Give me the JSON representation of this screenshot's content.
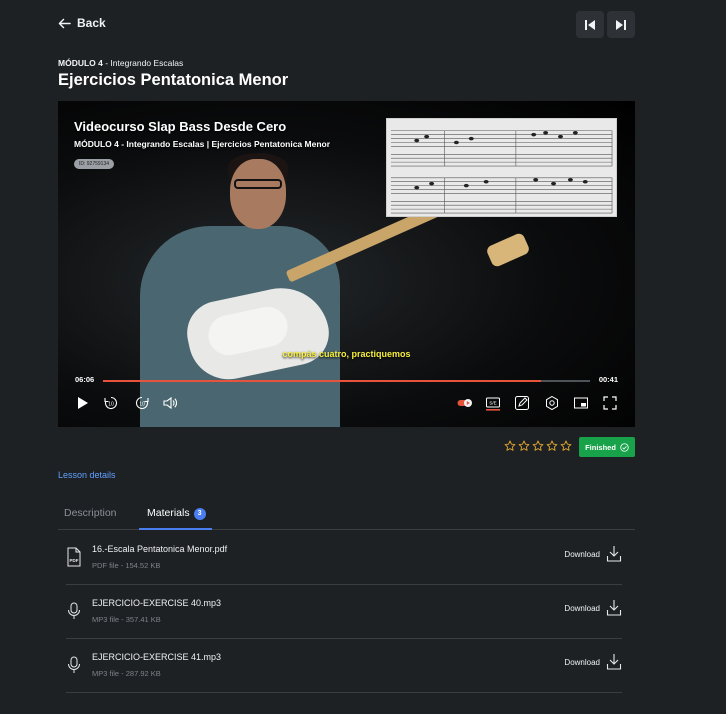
{
  "nav": {
    "back_label": "Back",
    "prev_icon": "skip-previous-icon",
    "next_icon": "skip-next-icon"
  },
  "lesson": {
    "module_bold": "MÓDULO 4",
    "module_rest": " - Integrando Escalas",
    "title": "Ejercicios Pentatonica Menor"
  },
  "video": {
    "overlay_title": "Videocurso Slap Bass Desde Cero",
    "overlay_subtitle": "MÓDULO 4 - Integrando Escalas | Ejercicios Pentatonica Menor",
    "id_badge": "ID: 92759134",
    "caption": "compás cuatro, practiquemos",
    "time_current": "06:06",
    "time_remaining": "00:41",
    "progress_fraction": 0.9,
    "progress_color": "#e6533c",
    "controls": [
      "play-icon",
      "rewind-10-icon",
      "forward-10-icon",
      "volume-icon",
      "speed-toggle-icon",
      "subtitles-icon",
      "notes-icon",
      "settings-icon",
      "picture-in-picture-icon",
      "fullscreen-icon"
    ]
  },
  "rating": {
    "stars": 5,
    "filled": 0,
    "star_color": "#e3a72f"
  },
  "status": {
    "finished_label": "Finished",
    "finished_color": "#18a34a"
  },
  "links": {
    "lesson_details": "Lesson details"
  },
  "tabs": {
    "description": "Description",
    "materials": "Materials",
    "materials_count": "3",
    "active_color": "#4a7ef0"
  },
  "materials": [
    {
      "name": "16.-Escala Pentatonica Menor.pdf",
      "meta": "PDF file - 154.52 KB",
      "icon": "pdf-file-icon",
      "download": "Download"
    },
    {
      "name": "EJERCICIO-EXERCISE 40.mp3",
      "meta": "MP3 file - 357.41 KB",
      "icon": "microphone-icon",
      "download": "Download"
    },
    {
      "name": "EJERCICIO-EXERCISE 41.mp3",
      "meta": "MP3 file - 287.92 KB",
      "icon": "microphone-icon",
      "download": "Download"
    }
  ]
}
